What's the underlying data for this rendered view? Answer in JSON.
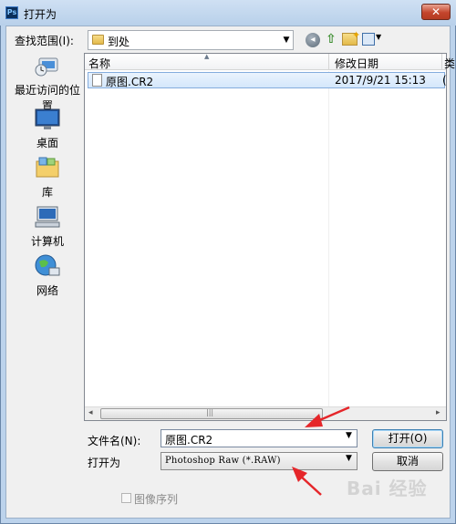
{
  "window": {
    "title": "打开为",
    "close_glyph": "✕"
  },
  "look_in": {
    "label": "查找范围(I):",
    "value": "到处"
  },
  "toolbar": {
    "icons": [
      "back-icon",
      "up-folder-icon",
      "new-folder-icon",
      "view-menu-icon"
    ]
  },
  "places": [
    {
      "label": "最近访问的位置",
      "icon": "recent-places-icon"
    },
    {
      "label": "桌面",
      "icon": "desktop-icon"
    },
    {
      "label": "库",
      "icon": "libraries-icon"
    },
    {
      "label": "计算机",
      "icon": "computer-icon"
    },
    {
      "label": "网络",
      "icon": "network-icon"
    }
  ],
  "file_list": {
    "columns": [
      "名称",
      "修改日期",
      "类"
    ],
    "rows": [
      {
        "name": "原图.CR2",
        "date": "2017/9/21 15:13",
        "extra": "("
      }
    ]
  },
  "scrollbar": {
    "left": "◂",
    "grip": "|||",
    "right": "▸"
  },
  "file_name": {
    "label": "文件名(N):",
    "value": "原图.CR2"
  },
  "open_as": {
    "label": "打开为",
    "value": "Photoshop Raw (*.RAW)"
  },
  "buttons": {
    "open": "打开(O)",
    "cancel": "取消"
  },
  "image_sequence": {
    "label": "图像序列",
    "checked": false
  },
  "watermark": "Bai 经验",
  "colors": {
    "selection": "#d4e7fb",
    "annotation_arrow": "#e5262a"
  }
}
